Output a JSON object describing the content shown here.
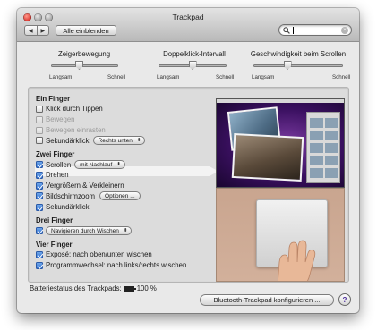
{
  "window": {
    "title": "Trackpad",
    "nav_back": "◀",
    "nav_forward": "▶",
    "show_all": "Alle einblenden",
    "search": {
      "value": "",
      "placeholder": ""
    }
  },
  "sliders": [
    {
      "title": "Zeigerbewegung",
      "min_label": "Langsam",
      "max_label": "Schnell",
      "value": 0.42
    },
    {
      "title": "Doppelklick-Intervall",
      "min_label": "Langsam",
      "max_label": "Schnell",
      "value": 0.5
    },
    {
      "title": "Geschwindigkeit beim Scrollen",
      "min_label": "Langsam",
      "max_label": "Schnell",
      "value": 0.38
    }
  ],
  "sections": {
    "one_finger": "Ein Finger",
    "two_fingers": "Zwei Finger",
    "three_fingers": "Drei Finger",
    "four_fingers": "Vier Finger"
  },
  "options": {
    "tap_to_click": {
      "label": "Klick durch Tippen",
      "checked": false
    },
    "drag": {
      "label": "Bewegen",
      "checked": false,
      "disabled": true
    },
    "drag_lock": {
      "label": "Bewegen einrasten",
      "checked": false,
      "disabled": true
    },
    "secondary_click": {
      "label": "Sekundärklick",
      "checked": false,
      "popup": "Rechts unten"
    },
    "scroll": {
      "label": "Scrollen",
      "checked": true,
      "popup": "mit Nachlauf"
    },
    "rotate": {
      "label": "Drehen",
      "checked": true
    },
    "pinch_zoom": {
      "label": "Vergrößern & Verkleinern",
      "checked": true
    },
    "screen_zoom": {
      "label": "Bildschirmzoom",
      "checked": true,
      "button": "Optionen ..."
    },
    "secondary_click_two": {
      "label": "Sekundärklick",
      "checked": true
    },
    "three_swipe": {
      "checked": true,
      "popup": "Navigieren durch Wischen"
    },
    "expose": {
      "label": "Exposé: nach oben/unten wischen",
      "checked": true
    },
    "app_switch": {
      "label": "Programmwechsel: nach links/rechts wischen",
      "checked": true
    }
  },
  "footer": {
    "battery_label": "Batteriestatus des Trackpads:",
    "battery_value": "100 %",
    "configure_button": "Bluetooth-Trackpad konfigurieren ...",
    "help": "?"
  }
}
